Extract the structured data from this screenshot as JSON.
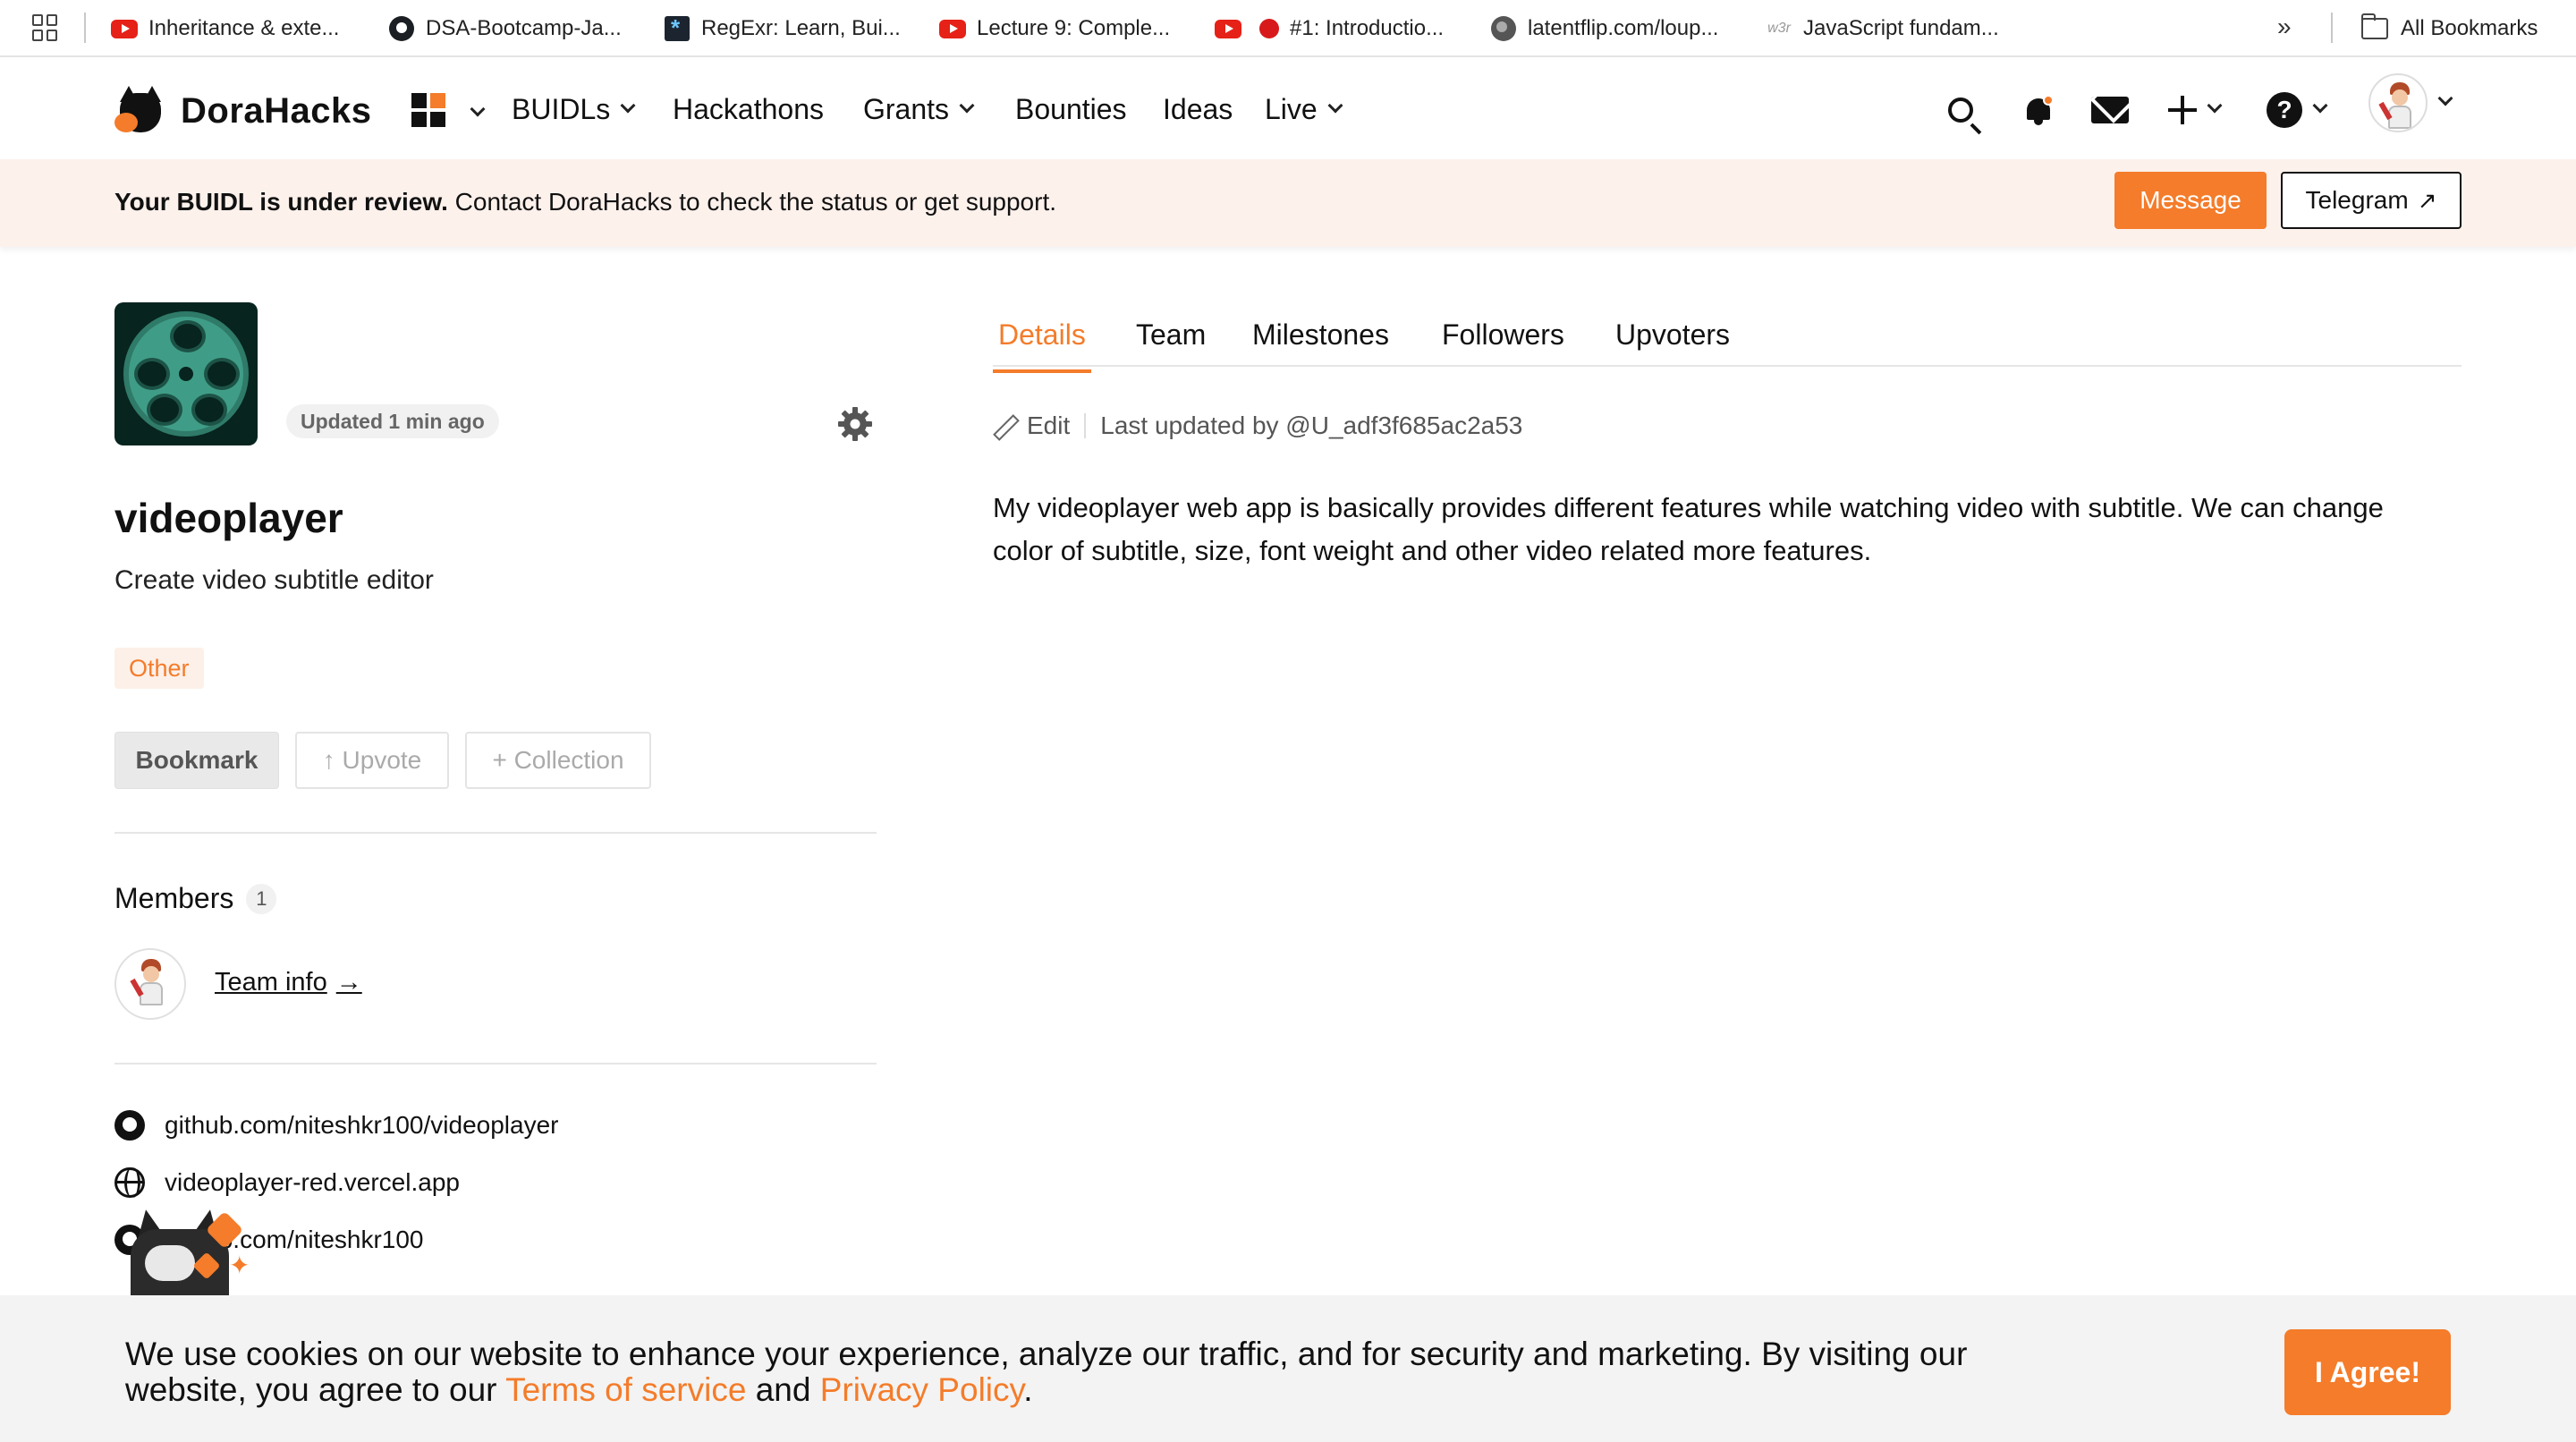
{
  "bookmarks": {
    "items": [
      {
        "label": "Inheritance & exte...",
        "icon": "youtube-icon"
      },
      {
        "label": "DSA-Bootcamp-Ja...",
        "icon": "github-icon"
      },
      {
        "label": "RegExr: Learn, Bui...",
        "icon": "regexr-icon"
      },
      {
        "label": "Lecture 9: Comple...",
        "icon": "youtube-icon"
      },
      {
        "label": "#1: Introductio...",
        "icon": "youtube-icon"
      },
      {
        "label": "latentflip.com/loup...",
        "icon": "globe-icon"
      },
      {
        "label": "JavaScript fundam...",
        "icon": "w3r-icon"
      }
    ],
    "w3r_mark": "w3r",
    "more": "»",
    "all_bookmarks": "All Bookmarks"
  },
  "nav": {
    "brand": "DoraHacks",
    "links": [
      "BUIDLs",
      "Hackathons",
      "Grants",
      "Bounties",
      "Ideas",
      "Live"
    ],
    "help_glyph": "?"
  },
  "banner": {
    "bold": "Your BUIDL is under review.",
    "text": " Contact DoraHacks to check the status or get support.",
    "message_btn": "Message",
    "telegram_btn": "Telegram",
    "telegram_arrow": "↗"
  },
  "project": {
    "updated": "Updated 1 min ago",
    "title": "videoplayer",
    "subtitle": "Create video subtitle editor",
    "tag": "Other",
    "bookmark_btn": "Bookmark",
    "upvote_btn": "↑ Upvote",
    "collection_btn": "+ Collection",
    "members_label": "Members",
    "members_count": "1",
    "team_info": "Team info",
    "team_arrow": "→",
    "links": [
      {
        "icon": "github-icon",
        "text": "github.com/niteshkr100/videoplayer"
      },
      {
        "icon": "globe-icon",
        "text": "videoplayer-red.vercel.app"
      },
      {
        "icon": "github-icon",
        "text": "github.com/niteshkr100"
      }
    ]
  },
  "tabs": [
    "Details",
    "Team",
    "Milestones",
    "Followers",
    "Upvoters"
  ],
  "details": {
    "edit_label": "Edit",
    "last_updated": "Last updated by @U_adf3f685ac2a53",
    "body": "My videoplayer web app is basically provides different features while watching video with subtitle. We can change color of subtitle, size, font weight and other video related more features."
  },
  "cookie": {
    "text_before": "We use cookies on our website to enhance your experience, analyze our traffic, and for security and marketing. By visiting our website, you agree to our ",
    "terms": "Terms of service",
    "and": " and ",
    "privacy": "Privacy Policy",
    "period": ".",
    "agree_btn": "I Agree!"
  },
  "colors": {
    "accent": "#f47c2a",
    "banner_bg": "#fdf1ec",
    "cookie_bg": "#f3f3f3"
  }
}
